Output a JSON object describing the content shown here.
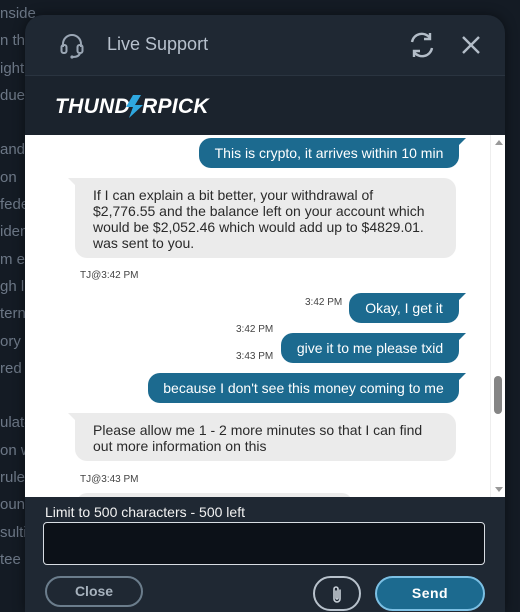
{
  "background_page": {
    "lines": [
      "nside",
      "n th",
      "ight",
      "due",
      "",
      "and",
      "on",
      "fede",
      "iden",
      "m ex",
      "gh li",
      "tern",
      "ory l",
      "red",
      "",
      "ulate",
      "on w",
      "rule",
      "ount",
      "sulti",
      "tee"
    ]
  },
  "header": {
    "title": "Live Support",
    "headset_icon": "headset-icon",
    "refresh_icon": "refresh-icon",
    "close_icon": "close-icon"
  },
  "brand": {
    "logo_text": "THUNDERPICK"
  },
  "messages": [
    {
      "sender": "user",
      "text": "This is crypto, it arrives within 10 min",
      "time": ""
    },
    {
      "sender": "agent",
      "text": "If I can explain a bit better, your withdrawal of $2,776.55 and the balance left on your account which would be $2,052.46 which would add up to $4829.01. was sent to you.",
      "stamp": "TJ@3:42 PM"
    },
    {
      "sender": "user",
      "text": "Okay, I get it",
      "time": "3:42 PM"
    },
    {
      "sender": "user",
      "text": "give it to me please txid",
      "time": "3:42 PM",
      "time2": "3:43 PM"
    },
    {
      "sender": "user",
      "text": "because I don't see this money coming to me",
      "time": ""
    },
    {
      "sender": "agent",
      "text": "Please allow me 1 - 2 more minutes so that I can find out more information on this",
      "stamp": "TJ@3:43 PM"
    }
  ],
  "composer": {
    "limit_text": "Limit to 500 characters - 500 left",
    "input_value": "",
    "close_label": "Close",
    "send_label": "Send",
    "attach_icon": "paperclip-icon"
  },
  "colors": {
    "user_bubble": "#1c6a8f",
    "agent_bubble": "#ebebeb",
    "header_bg": "#1f2833",
    "accent_bolt": "#2fa8e0"
  }
}
